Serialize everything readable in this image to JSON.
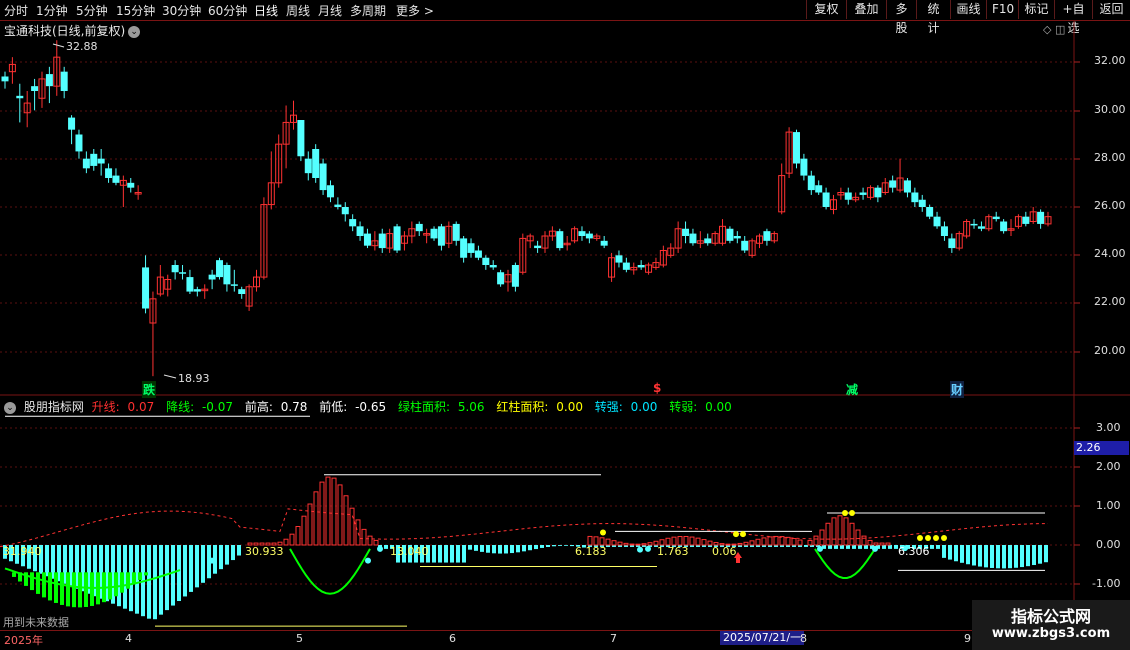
{
  "topbar": {
    "periods": [
      "分时",
      "1分钟",
      "5分钟",
      "15分钟",
      "30分钟",
      "60分钟",
      "日线",
      "周线",
      "月线",
      "多周期",
      "更多"
    ],
    "active": "日线",
    "right_buttons": [
      "复权",
      "叠加",
      "多股",
      "统计",
      "画线",
      "F10",
      "标记",
      "+自选",
      "返回"
    ]
  },
  "stock": {
    "title": "宝通科技(日线,前复权)",
    "high_label": "32.88",
    "low_label": "18.93"
  },
  "price_axis": {
    "ticks": [
      "32.00",
      "30.00",
      "28.00",
      "26.00",
      "24.00",
      "22.00",
      "20.00"
    ]
  },
  "tags": [
    "跌",
    "$",
    "减",
    "财"
  ],
  "indicator": {
    "name": "股朋指标网",
    "items": [
      {
        "label": "升线: ",
        "value": "0.07",
        "color": "#ff3030"
      },
      {
        "label": "降线: ",
        "value": "-0.07",
        "color": "#00ff00"
      },
      {
        "label": "前高: ",
        "value": "0.78",
        "color": "#ffffff"
      },
      {
        "label": "前低: ",
        "value": "-0.65",
        "color": "#ffffff"
      },
      {
        "label": "绿柱面积: ",
        "value": "5.06",
        "color": "#00ff00"
      },
      {
        "label": "红柱面积: ",
        "value": "0.00",
        "color": "#ffff00"
      },
      {
        "label": "转强: ",
        "value": "0.00",
        "color": "#00e5ff"
      },
      {
        "label": "转弱: ",
        "value": "0.00",
        "color": "#00ff00"
      }
    ],
    "axis_ticks": [
      "3.00",
      "2.00",
      "1.00",
      "0.00",
      "-1.00"
    ],
    "current_value": "2.26",
    "area_labels": [
      "31.940",
      "30.933",
      "13.040",
      "6.183",
      "1.763",
      "0.06",
      "6.306"
    ]
  },
  "future_data_label": "用到未来数据",
  "xaxis": {
    "ticks": [
      "2025年",
      "4",
      "5",
      "6",
      "7",
      "8",
      "9"
    ],
    "date_box": "2025/07/21/一"
  },
  "watermark": {
    "line1": "指标公式网",
    "line2": "www.zbgs3.com"
  },
  "colors": {
    "up": "#ff3232",
    "down": "#54ffff",
    "grid": "#7a1414",
    "green_bar": "#00ff00"
  }
}
